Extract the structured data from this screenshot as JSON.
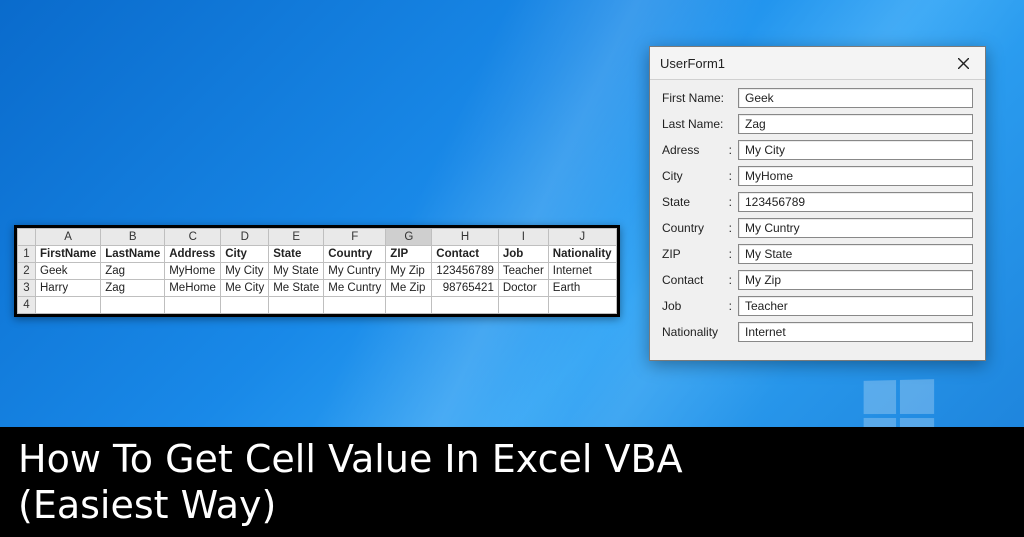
{
  "sheet": {
    "col_letters": [
      "A",
      "B",
      "C",
      "D",
      "E",
      "F",
      "G",
      "H",
      "I",
      "J"
    ],
    "selected_col": "G",
    "headers": [
      "FirstName",
      "LastName",
      "Address",
      "City",
      "State",
      "Country",
      "ZIP",
      "Contact",
      "Job",
      "Nationality"
    ],
    "rows": [
      [
        "Geek",
        "Zag",
        "MyHome",
        "My City",
        "My State",
        "My Cuntry",
        "My Zip",
        "123456789",
        "Teacher",
        "Internet"
      ],
      [
        "Harry",
        "Zag",
        "MeHome",
        "Me City",
        "Me State",
        "Me Cuntry",
        "Me Zip",
        "98765421",
        "Doctor",
        "Earth"
      ]
    ],
    "row_nums": [
      "1",
      "2",
      "3",
      "4"
    ]
  },
  "userform": {
    "title": "UserForm1",
    "fields": [
      {
        "label": "First Name:",
        "value": "Geek"
      },
      {
        "label": "Last Name:",
        "value": "Zag"
      },
      {
        "label": "Adress",
        "colon": ":",
        "value": "My City"
      },
      {
        "label": "City",
        "colon": ":",
        "value": "MyHome"
      },
      {
        "label": "State",
        "colon": ":",
        "value": "123456789"
      },
      {
        "label": "Country",
        "colon": ":",
        "value": "My Cuntry"
      },
      {
        "label": "ZIP",
        "colon": ":",
        "value": "My State"
      },
      {
        "label": "Contact",
        "colon": ":",
        "value": "My Zip"
      },
      {
        "label": "Job",
        "colon": ":",
        "value": "Teacher"
      },
      {
        "label": "Nationality",
        "value": "Internet"
      }
    ]
  },
  "caption": {
    "line1": "How To Get Cell Value In Excel VBA",
    "line2": "(Easiest Way)"
  }
}
